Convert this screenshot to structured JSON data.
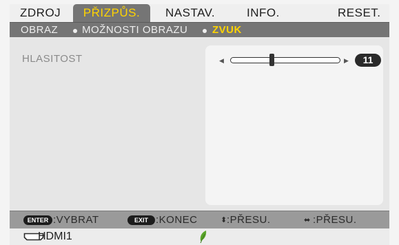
{
  "tabs": [
    {
      "label": "ZDROJ",
      "active": false
    },
    {
      "label": "PŘIZPŮS.",
      "active": true
    },
    {
      "label": "NASTAV.",
      "active": false
    },
    {
      "label": "INFO.",
      "active": false
    },
    {
      "label": "RESET.",
      "active": false
    }
  ],
  "breadcrumb": [
    "OBRAZ",
    "MOŽNOSTI OBRAZU",
    "ZVUK"
  ],
  "setting": {
    "label": "HLASITOST",
    "value": "11",
    "level_fraction": 0.38
  },
  "footer": {
    "enter_badge": "ENTER",
    "enter_label": ":VYBRAT",
    "exit_badge": "EXIT",
    "exit_label": ":KONEC",
    "updown_label": ":PŘESU.",
    "leftright_label": ":PŘESU."
  },
  "status": {
    "source": "HDMI1",
    "eco_icon": "leaf-icon"
  },
  "colors": {
    "active_tab_text": "#ffd400",
    "active_tab_bg": "#757575",
    "eco_leaf": "#5aa52a"
  }
}
